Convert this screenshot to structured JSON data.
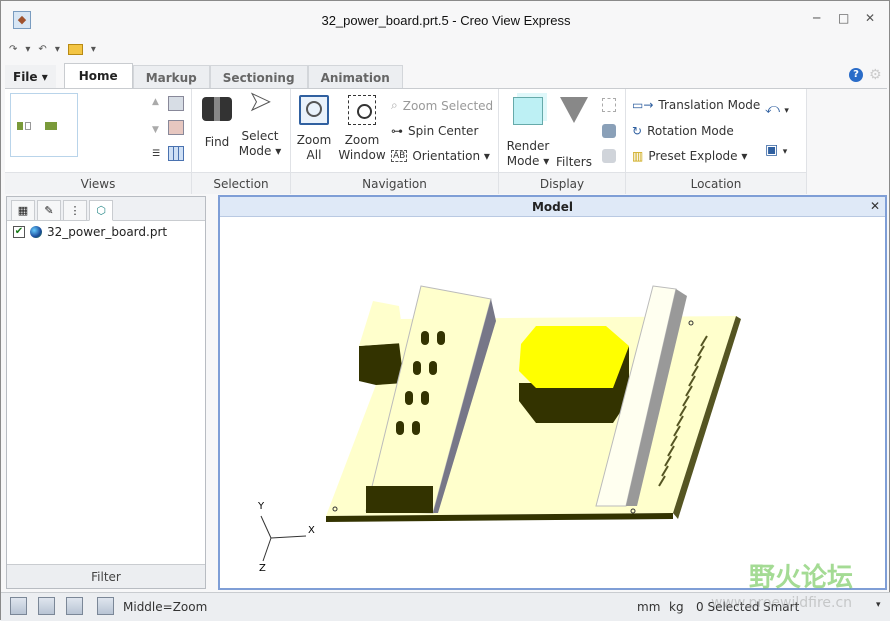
{
  "window": {
    "title": "32_power_board.prt.5 - Creo View Express",
    "minimize": "─",
    "maximize": "□",
    "close": "✕"
  },
  "qat": {
    "redo": "↷",
    "undo": "↶",
    "open": "open-folder-icon",
    "more": "▾"
  },
  "tabs": {
    "file": "File",
    "items": [
      "Home",
      "Markup",
      "Sectioning",
      "Animation"
    ],
    "active": "Home"
  },
  "ribbon": {
    "views": {
      "label": "Views"
    },
    "selection": {
      "label": "Selection",
      "find": "Find",
      "select_mode_1": "Select",
      "select_mode_2": "Mode ▾"
    },
    "navigation": {
      "label": "Navigation",
      "zoom_all_1": "Zoom",
      "zoom_all_2": "All",
      "zoom_window_1": "Zoom",
      "zoom_window_2": "Window",
      "zoom_selected": "Zoom Selected",
      "spin_center": "Spin Center",
      "orientation": "Orientation ▾"
    },
    "display": {
      "label": "Display",
      "render_mode_1": "Render",
      "render_mode_2": "Mode ▾",
      "filters": "Filters"
    },
    "location": {
      "label": "Location",
      "translation": "Translation Mode",
      "rotation": "Rotation Mode",
      "preset_explode": "Preset Explode ▾"
    }
  },
  "panel": {
    "tree_item": "32_power_board.prt",
    "tree_checked": true,
    "filter": "Filter"
  },
  "viewport": {
    "title": "Model",
    "axes": {
      "x": "X",
      "y": "Y",
      "z": "Z"
    }
  },
  "status": {
    "mouse_hint": "Middle=Zoom",
    "length_unit": "mm",
    "mass_unit": "kg",
    "selected": "0 Selected",
    "selection_filter": "Smart"
  },
  "watermark": {
    "cn": "野火论坛",
    "url": "www.proewildfire.cn"
  },
  "colors": {
    "accent": "#7f9ed6",
    "board": "#ffffcc",
    "component": "#ffff00",
    "shadow": "#333300"
  }
}
